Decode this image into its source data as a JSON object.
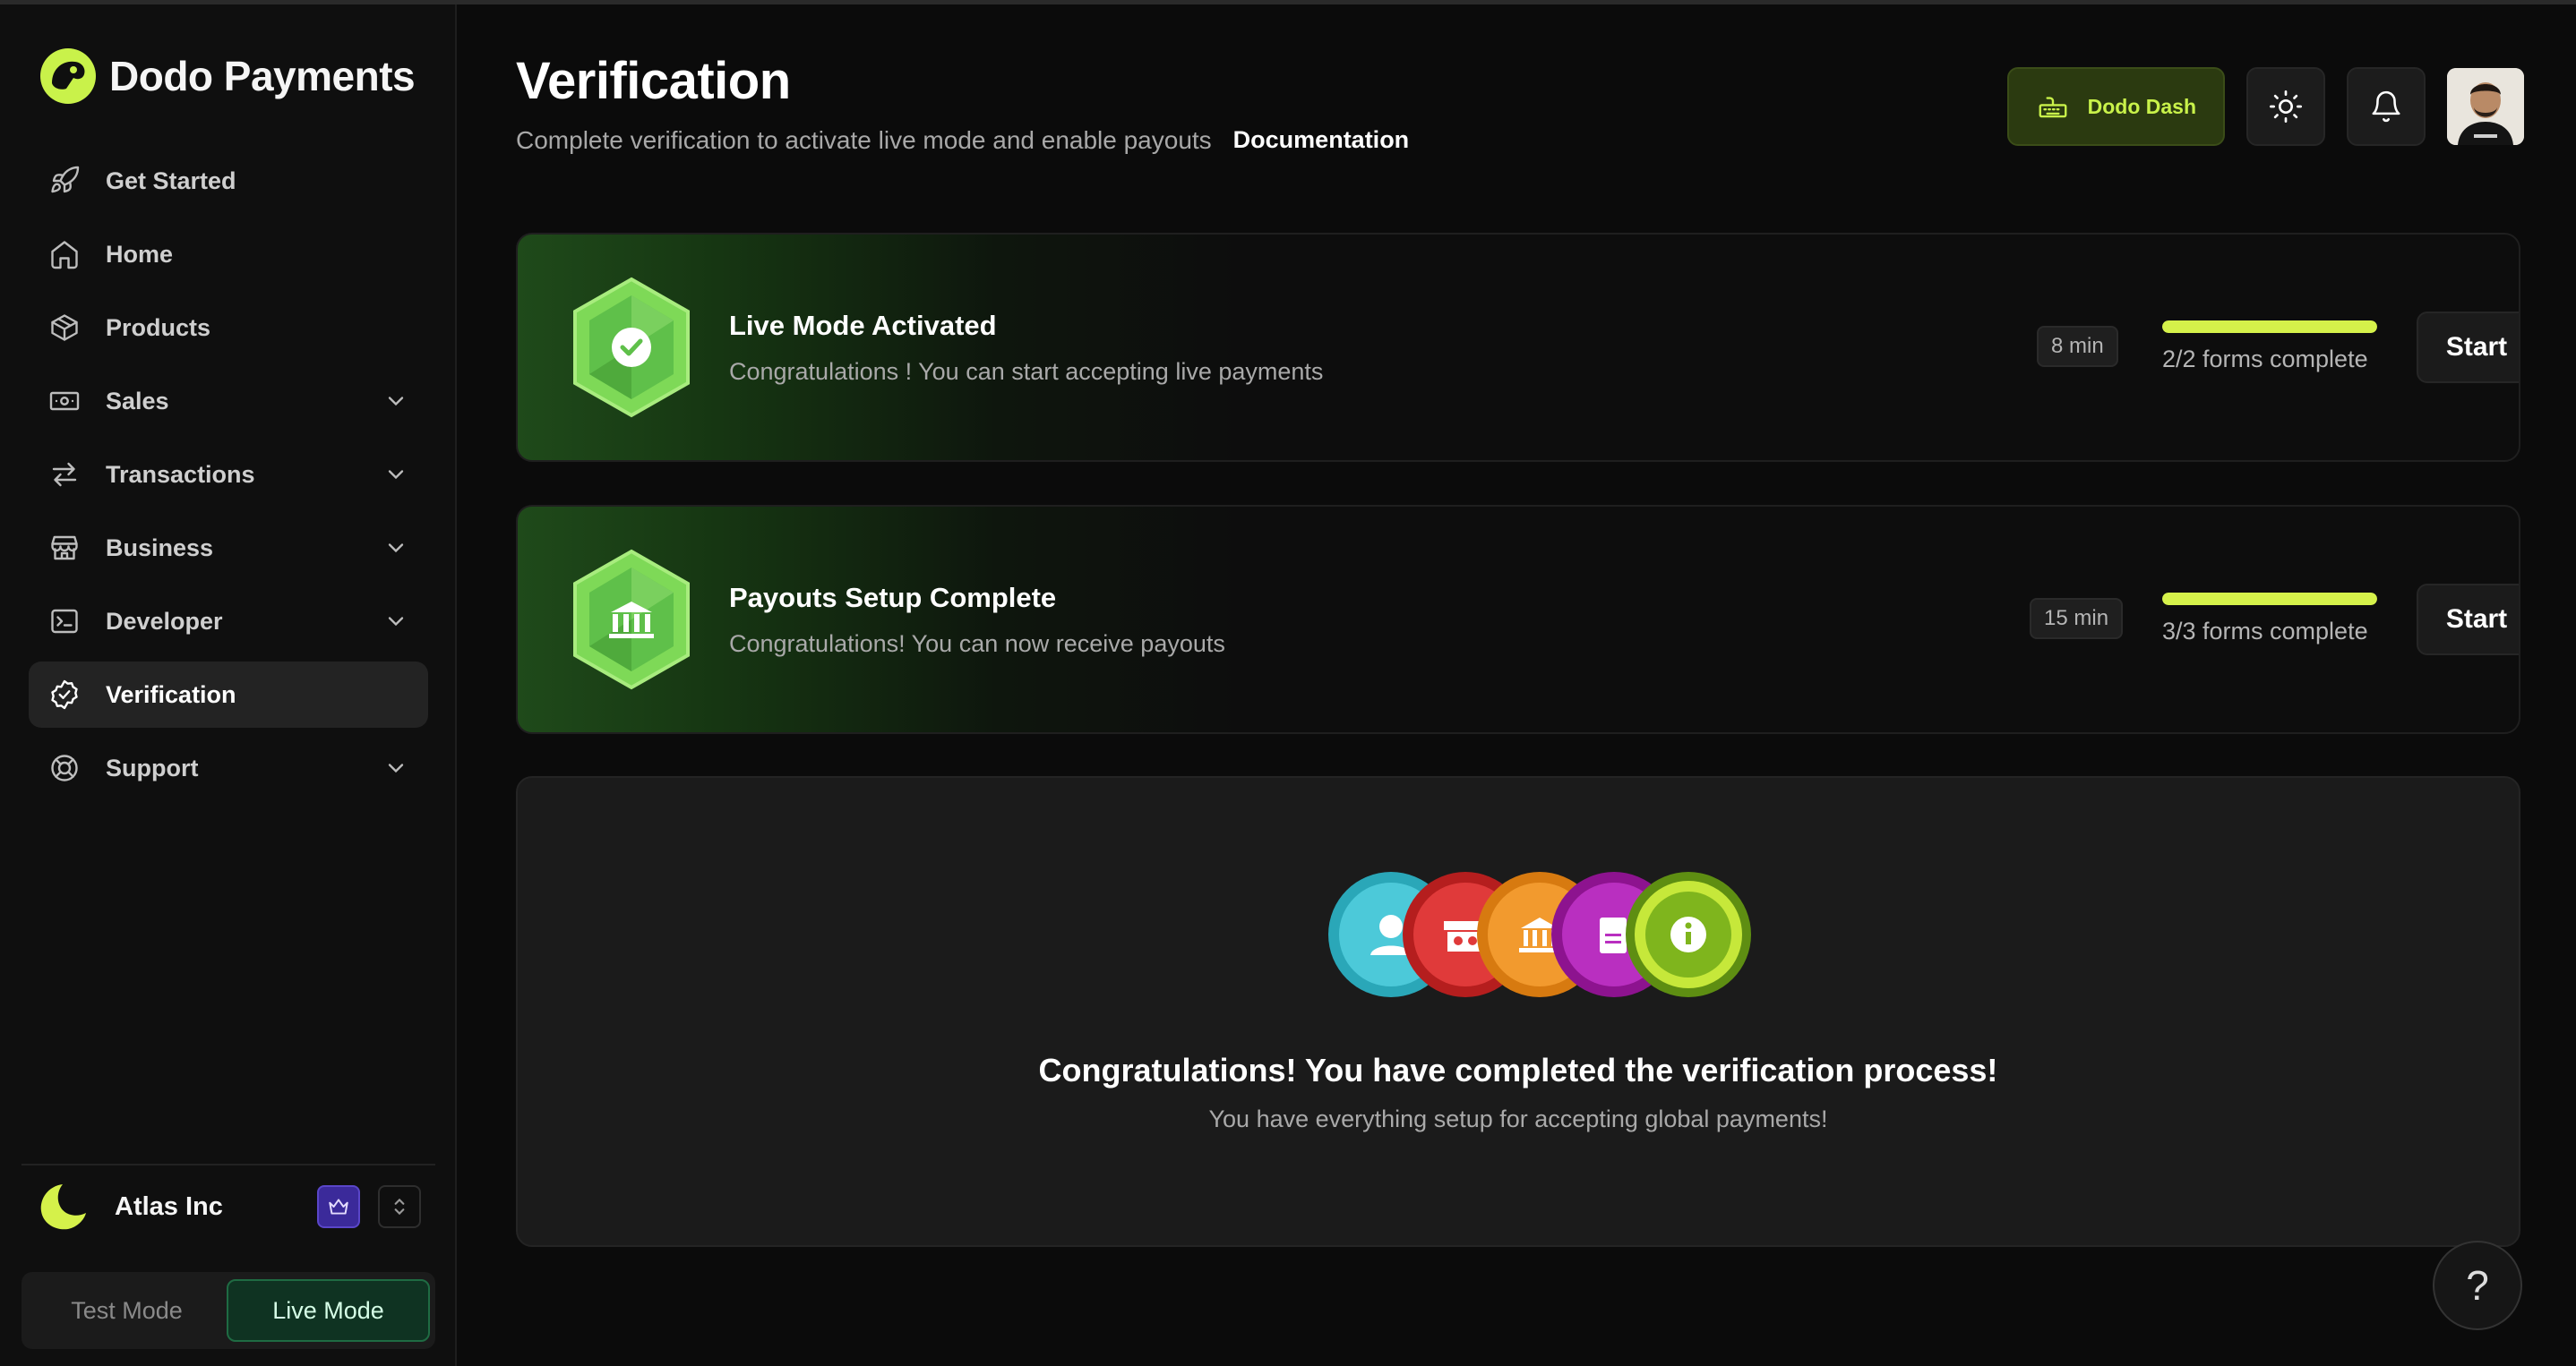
{
  "brand": {
    "name": "Dodo Payments"
  },
  "nav": {
    "items": [
      {
        "label": "Get Started",
        "icon": "rocket-icon"
      },
      {
        "label": "Home",
        "icon": "home-icon"
      },
      {
        "label": "Products",
        "icon": "box-icon"
      },
      {
        "label": "Sales",
        "icon": "banknote-icon"
      },
      {
        "label": "Transactions",
        "icon": "arrows-icon"
      },
      {
        "label": "Business",
        "icon": "store-icon"
      },
      {
        "label": "Developer",
        "icon": "terminal-icon"
      },
      {
        "label": "Verification",
        "icon": "badge-check-icon"
      },
      {
        "label": "Support",
        "icon": "lifebuoy-icon"
      }
    ]
  },
  "org": {
    "name": "Atlas Inc"
  },
  "modes": {
    "test": "Test Mode",
    "live": "Live Mode",
    "active": "live"
  },
  "page": {
    "title": "Verification",
    "subtitle": "Complete verification to activate live mode and enable payouts",
    "doc_link": "Documentation"
  },
  "header": {
    "dodo_dash": "Dodo Dash"
  },
  "cards": [
    {
      "title": "Live Mode Activated",
      "description": "Congratulations ! You can start accepting live payments",
      "time": "8 min",
      "progress_label": "2/2 forms complete",
      "progress": 1.0,
      "button": "Start"
    },
    {
      "title": "Payouts Setup Complete",
      "description": "Congratulations! You can now receive payouts",
      "time": "15 min",
      "progress_label": "3/3 forms complete",
      "progress": 1.0,
      "button": "Start"
    }
  ],
  "completion": {
    "title": "Congratulations! You have completed the verification process!",
    "subtitle": "You have everything setup for accepting global payments!"
  },
  "help": {
    "label": "?"
  },
  "colors": {
    "accent": "#d5f14a",
    "live_green": "#1f6b43",
    "badge_green": "#5fc04a"
  }
}
